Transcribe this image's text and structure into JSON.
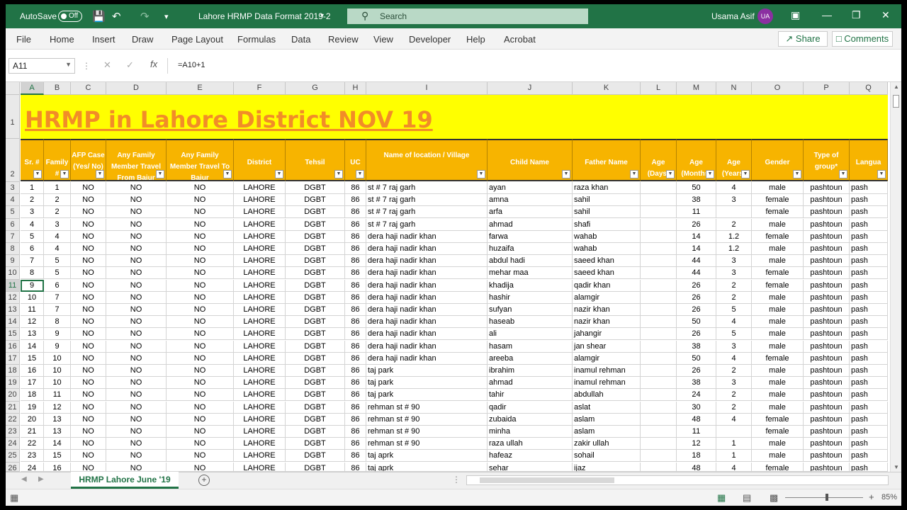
{
  "titlebar": {
    "autosave_label": "AutoSave",
    "autosave_state": "Off",
    "doc_title": "Lahore HRMP Data Format 2019-2",
    "search_placeholder": "Search",
    "user_name": "Usama Asif",
    "user_initials": "UA"
  },
  "ribbon": {
    "tabs": [
      "File",
      "Home",
      "Insert",
      "Draw",
      "Page Layout",
      "Formulas",
      "Data",
      "Review",
      "View",
      "Developer",
      "Help",
      "Acrobat"
    ],
    "share": "Share",
    "comments": "Comments"
  },
  "formula_bar": {
    "cell_ref": "A11",
    "formula": "=A10+1"
  },
  "columns": [
    "A",
    "B",
    "C",
    "D",
    "E",
    "F",
    "G",
    "H",
    "I",
    "J",
    "K",
    "L",
    "M",
    "N",
    "O",
    "P",
    "Q"
  ],
  "active_column": "A",
  "sheet_title": "HRMP in Lahore District NOV 19",
  "headers": [
    "Sr. #",
    "Family #",
    "AFP Case (Yes/ No)",
    "Any Family Member Travel From Bajur",
    "Any Family Member Travel To Bajur",
    "District",
    "Tehsil",
    "UC",
    "Name of location / Village",
    "Child Name",
    "Father Name",
    "Age (Days)",
    "Age (Months)",
    "Age (Years)",
    "Gender",
    "Type of group*",
    "Langua"
  ],
  "row_numbers": [
    "1",
    "2",
    "3",
    "4",
    "5",
    "6",
    "7",
    "8",
    "9",
    "10",
    "11",
    "12",
    "13",
    "14",
    "15",
    "16",
    "17",
    "18",
    "19",
    "20",
    "21",
    "22",
    "23",
    "24",
    "25",
    "26"
  ],
  "active_row": "11",
  "rows": [
    [
      "1",
      "1",
      "NO",
      "NO",
      "NO",
      "LAHORE",
      "DGBT",
      "86",
      "st # 7 raj garh",
      "ayan",
      "raza khan",
      "",
      "50",
      "4",
      "male",
      "pashtoun",
      "pash"
    ],
    [
      "2",
      "2",
      "NO",
      "NO",
      "NO",
      "LAHORE",
      "DGBT",
      "86",
      "st # 7 raj garh",
      "amna",
      "sahil",
      "",
      "38",
      "3",
      "female",
      "pashtoun",
      "pash"
    ],
    [
      "3",
      "2",
      "NO",
      "NO",
      "NO",
      "LAHORE",
      "DGBT",
      "86",
      "st # 7 raj garh",
      "arfa",
      "sahil",
      "",
      "11",
      "",
      "female",
      "pashtoun",
      "pash"
    ],
    [
      "4",
      "3",
      "NO",
      "NO",
      "NO",
      "LAHORE",
      "DGBT",
      "86",
      "st # 7 raj garh",
      "ahmad",
      "shafi",
      "",
      "26",
      "2",
      "male",
      "pashtoun",
      "pash"
    ],
    [
      "5",
      "4",
      "NO",
      "NO",
      "NO",
      "LAHORE",
      "DGBT",
      "86",
      "dera haji nadir khan",
      "farwa",
      "wahab",
      "",
      "14",
      "1.2",
      "female",
      "pashtoun",
      "pash"
    ],
    [
      "6",
      "4",
      "NO",
      "NO",
      "NO",
      "LAHORE",
      "DGBT",
      "86",
      "dera haji nadir khan",
      "huzaifa",
      "wahab",
      "",
      "14",
      "1.2",
      "male",
      "pashtoun",
      "pash"
    ],
    [
      "7",
      "5",
      "NO",
      "NO",
      "NO",
      "LAHORE",
      "DGBT",
      "86",
      "dera haji nadir khan",
      "abdul hadi",
      "saeed khan",
      "",
      "44",
      "3",
      "male",
      "pashtoun",
      "pash"
    ],
    [
      "8",
      "5",
      "NO",
      "NO",
      "NO",
      "LAHORE",
      "DGBT",
      "86",
      "dera haji nadir khan",
      "mehar maa",
      "saeed khan",
      "",
      "44",
      "3",
      "female",
      "pashtoun",
      "pash"
    ],
    [
      "9",
      "6",
      "NO",
      "NO",
      "NO",
      "LAHORE",
      "DGBT",
      "86",
      "dera haji nadir khan",
      "khadija",
      "qadir khan",
      "",
      "26",
      "2",
      "female",
      "pashtoun",
      "pash"
    ],
    [
      "10",
      "7",
      "NO",
      "NO",
      "NO",
      "LAHORE",
      "DGBT",
      "86",
      "dera haji nadir khan",
      "hashir",
      "alamgir",
      "",
      "26",
      "2",
      "male",
      "pashtoun",
      "pash"
    ],
    [
      "11",
      "7",
      "NO",
      "NO",
      "NO",
      "LAHORE",
      "DGBT",
      "86",
      "dera haji nadir khan",
      "sufyan",
      "nazir khan",
      "",
      "26",
      "5",
      "male",
      "pashtoun",
      "pash"
    ],
    [
      "12",
      "8",
      "NO",
      "NO",
      "NO",
      "LAHORE",
      "DGBT",
      "86",
      "dera haji nadir khan",
      "haseab",
      "nazir khan",
      "",
      "50",
      "4",
      "male",
      "pashtoun",
      "pash"
    ],
    [
      "13",
      "9",
      "NO",
      "NO",
      "NO",
      "LAHORE",
      "DGBT",
      "86",
      "dera haji nadir khan",
      "ali",
      "jahangir",
      "",
      "26",
      "5",
      "male",
      "pashtoun",
      "pash"
    ],
    [
      "14",
      "9",
      "NO",
      "NO",
      "NO",
      "LAHORE",
      "DGBT",
      "86",
      "dera haji nadir khan",
      "hasam",
      "jan shear",
      "",
      "38",
      "3",
      "male",
      "pashtoun",
      "pash"
    ],
    [
      "15",
      "10",
      "NO",
      "NO",
      "NO",
      "LAHORE",
      "DGBT",
      "86",
      "dera haji nadir khan",
      "areeba",
      "alamgir",
      "",
      "50",
      "4",
      "female",
      "pashtoun",
      "pash"
    ],
    [
      "16",
      "10",
      "NO",
      "NO",
      "NO",
      "LAHORE",
      "DGBT",
      "86",
      "taj park",
      "ibrahim",
      "inamul rehman",
      "",
      "26",
      "2",
      "male",
      "pashtoun",
      "pash"
    ],
    [
      "17",
      "10",
      "NO",
      "NO",
      "NO",
      "LAHORE",
      "DGBT",
      "86",
      "taj park",
      "ahmad",
      "inamul rehman",
      "",
      "38",
      "3",
      "male",
      "pashtoun",
      "pash"
    ],
    [
      "18",
      "11",
      "NO",
      "NO",
      "NO",
      "LAHORE",
      "DGBT",
      "86",
      "taj park",
      "tahir",
      "abdullah",
      "",
      "24",
      "2",
      "male",
      "pashtoun",
      "pash"
    ],
    [
      "19",
      "12",
      "NO",
      "NO",
      "NO",
      "LAHORE",
      "DGBT",
      "86",
      "rehman st # 90",
      "qadir",
      "aslat",
      "",
      "30",
      "2",
      "male",
      "pashtoun",
      "pash"
    ],
    [
      "20",
      "13",
      "NO",
      "NO",
      "NO",
      "LAHORE",
      "DGBT",
      "86",
      "rehman st # 90",
      "zubaida",
      "aslam",
      "",
      "48",
      "4",
      "female",
      "pashtoun",
      "pash"
    ],
    [
      "21",
      "13",
      "NO",
      "NO",
      "NO",
      "LAHORE",
      "DGBT",
      "86",
      "rehman st # 90",
      "minha",
      "aslam",
      "",
      "11",
      "",
      "female",
      "pashtoun",
      "pash"
    ],
    [
      "22",
      "14",
      "NO",
      "NO",
      "NO",
      "LAHORE",
      "DGBT",
      "86",
      "rehman st # 90",
      "raza ullah",
      "zakir ullah",
      "",
      "12",
      "1",
      "male",
      "pashtoun",
      "pash"
    ],
    [
      "23",
      "15",
      "NO",
      "NO",
      "NO",
      "LAHORE",
      "DGBT",
      "86",
      "taj aprk",
      "hafeaz",
      "sohail",
      "",
      "18",
      "1",
      "male",
      "pashtoun",
      "pash"
    ],
    [
      "24",
      "16",
      "NO",
      "NO",
      "NO",
      "LAHORE",
      "DGBT",
      "86",
      "taj aprk",
      "sehar",
      "ijaz",
      "",
      "48",
      "4",
      "female",
      "pashtoun",
      "pash"
    ]
  ],
  "sheet_tabs": [
    "HRMP Lahore June '19"
  ],
  "zoom": "85%",
  "colors": {
    "excel_green": "#217346",
    "header_fill": "#f7b400",
    "title_fill": "#ffff00",
    "title_text": "#f28c28"
  }
}
